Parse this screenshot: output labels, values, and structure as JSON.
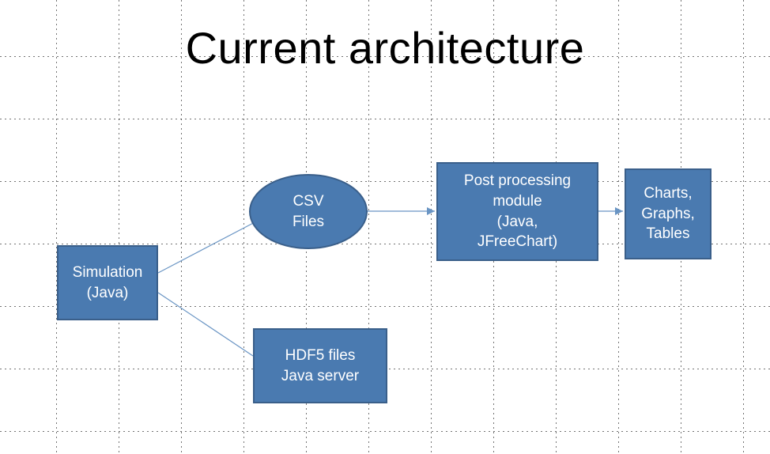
{
  "title": "Current architecture",
  "nodes": {
    "simulation": {
      "label": "Simulation\n(Java)"
    },
    "csv": {
      "label": "CSV\nFiles"
    },
    "hdf5": {
      "label": "HDF5 files\nJava server"
    },
    "post": {
      "label": "Post processing\nmodule\n(Java,\nJFreeChart)"
    },
    "output": {
      "label": "Charts,\nGraphs,\nTables"
    }
  },
  "colors": {
    "node_fill": "#4a7ab0",
    "node_stroke": "#3a5f8a",
    "connector": "#6a95c4"
  },
  "edges": [
    {
      "from": "simulation",
      "to": "csv",
      "arrow": false
    },
    {
      "from": "simulation",
      "to": "hdf5",
      "arrow": false
    },
    {
      "from": "csv",
      "to": "post",
      "arrow": true
    },
    {
      "from": "post",
      "to": "output",
      "arrow": true
    }
  ]
}
